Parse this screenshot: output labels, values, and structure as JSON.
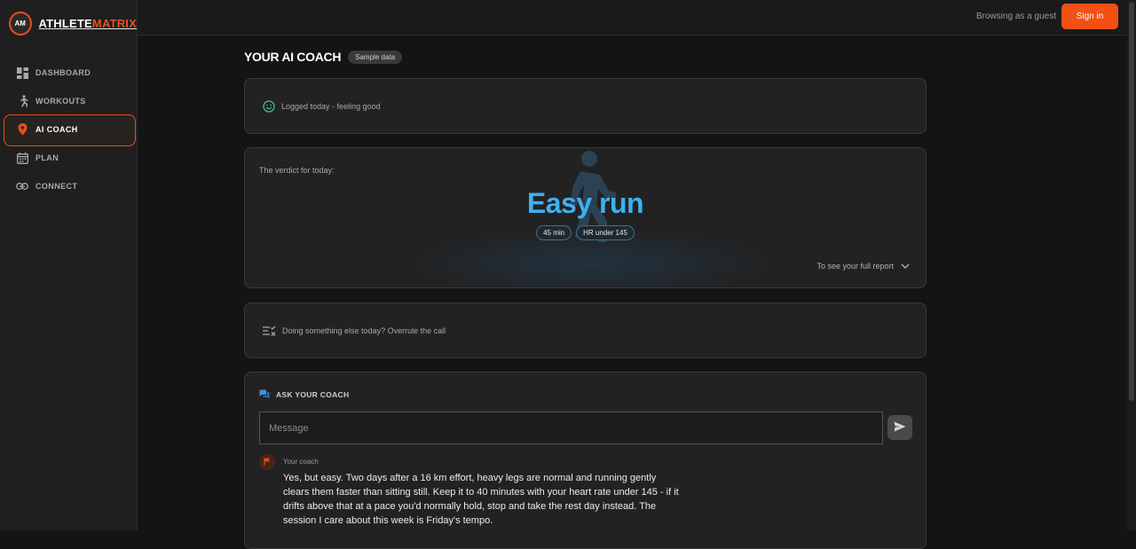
{
  "brand": {
    "logo_text": "AM",
    "name_part1": "ATHLETE",
    "name_part2": "MATRIX",
    "accent_color": "#e8501e"
  },
  "sidebar": {
    "items": [
      {
        "label": "DASHBOARD",
        "icon": "dashboard-icon"
      },
      {
        "label": "WORKOUTS",
        "icon": "running-icon"
      },
      {
        "label": "AI COACH",
        "icon": "map-pin-icon",
        "active": true
      },
      {
        "label": "PLAN",
        "icon": "calendar-icon"
      },
      {
        "label": "CONNECT",
        "icon": "link-icon"
      }
    ]
  },
  "topbar": {
    "guest_text": "Browsing as a guest",
    "signin_label": "Sign in"
  },
  "page": {
    "title": "YOUR AI COACH",
    "badge": "Sample data"
  },
  "log_card": {
    "text": "Logged today - feeling good",
    "icon": "smile-icon"
  },
  "verdict_card": {
    "label": "The verdict for today:",
    "verdict": "Easy run",
    "verdict_color": "#3fb0f0",
    "pills": [
      "45 min",
      "HR under 145"
    ],
    "report_link": "To see your full report",
    "icon": "running-icon"
  },
  "override_card": {
    "text": "Doing something else today? Overrule the call",
    "icon": "checklist-icon"
  },
  "ask_card": {
    "heading": "ASK YOUR COACH",
    "input_placeholder": "Message",
    "coach_label": "Your coach",
    "coach_message": "Yes, but easy. Two days after a 16 km effort, heavy legs are normal and running gently clears them faster than sitting still. Keep it to 40 minutes with your heart rate under 145 - if it drifts above that at a pace you'd normally hold, stop and take the rest day instead. The session I care about this week is Friday's tempo."
  }
}
